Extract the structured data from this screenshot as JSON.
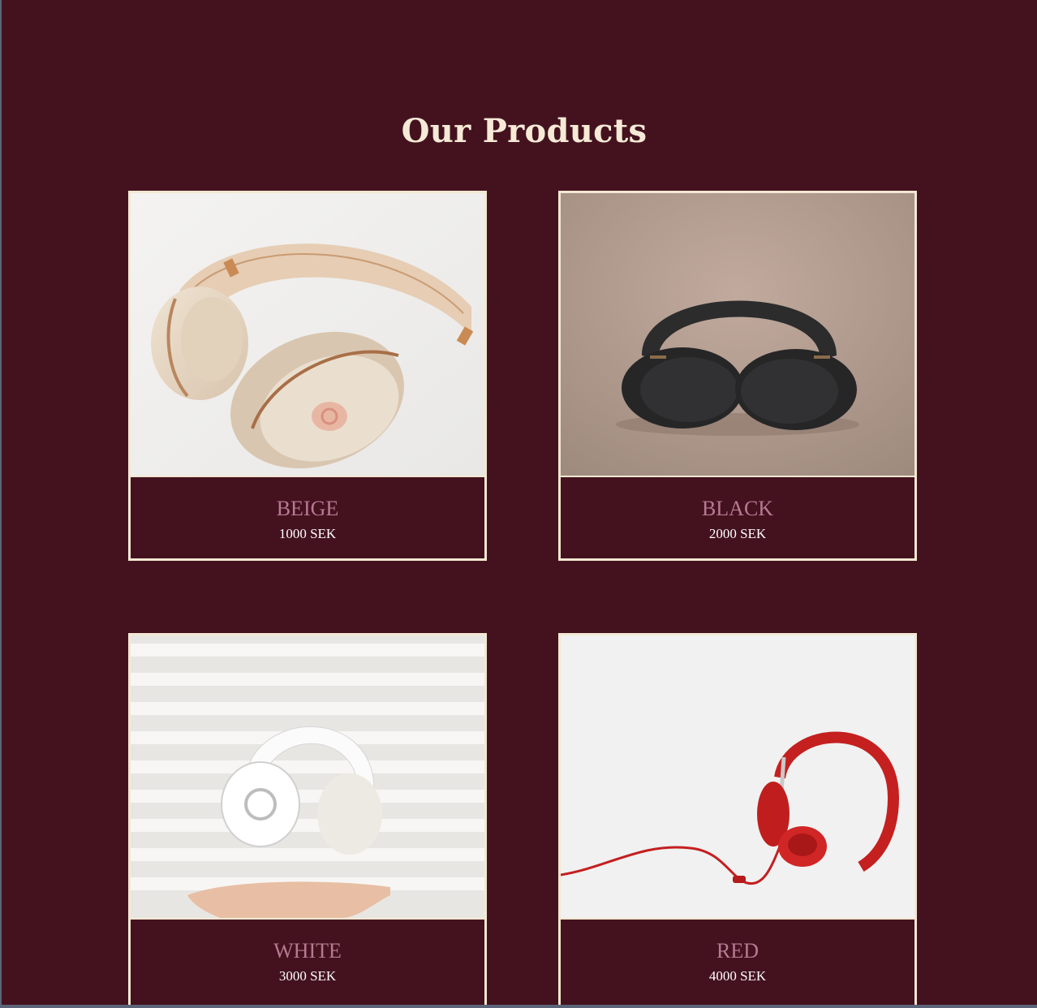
{
  "section": {
    "title": "Our Products"
  },
  "products": [
    {
      "name": "BEIGE",
      "price": "1000 SEK",
      "image": "beige-headphones-photo"
    },
    {
      "name": "BLACK",
      "price": "2000 SEK",
      "image": "black-headphones-photo"
    },
    {
      "name": "WHITE",
      "price": "3000 SEK",
      "image": "white-headphones-photo"
    },
    {
      "name": "RED",
      "price": "4000 SEK",
      "image": "red-headphones-photo"
    }
  ],
  "colors": {
    "background": "#44121f",
    "title": "#f6ead6",
    "border": "#f3e8d3",
    "product_name": "#b77a93",
    "price": "#ffffff"
  }
}
